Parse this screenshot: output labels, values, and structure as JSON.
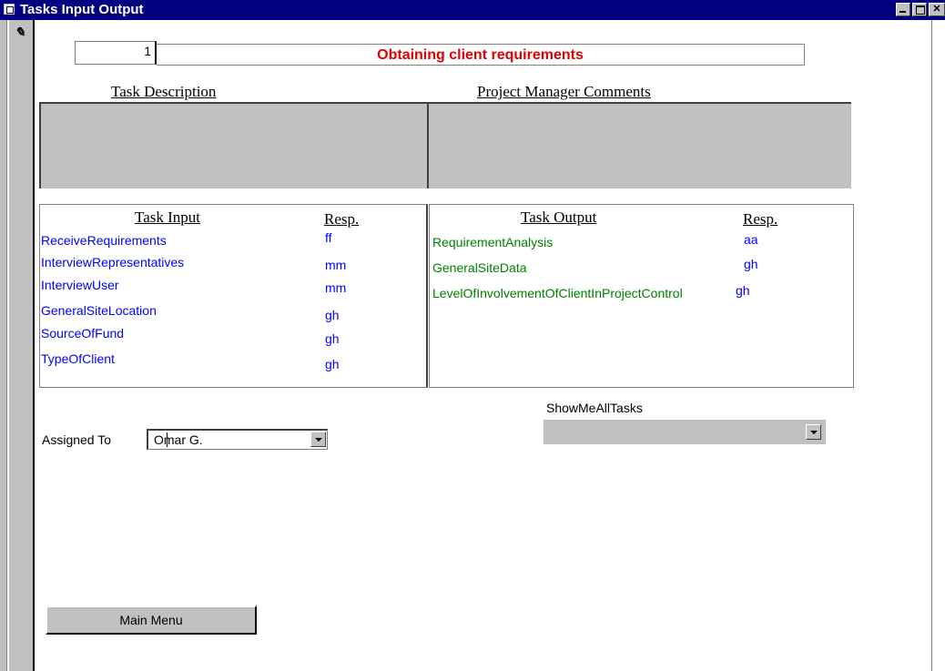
{
  "window": {
    "title": "Tasks Input Output",
    "controls": [
      "minimize",
      "maximize",
      "close"
    ]
  },
  "record_selector": {
    "icon": "pencil-icon"
  },
  "task": {
    "id": "1",
    "name": "Obtaining client requirements",
    "name_color": "#e00000"
  },
  "headers": {
    "task_description": "Task Description",
    "pm_comments": "Project Manager Comments"
  },
  "task_input": {
    "header": "Task Input",
    "resp_header": "Resp.",
    "color": "#0000ff",
    "items": [
      {
        "name": "ReceiveRequirements",
        "resp": "ff"
      },
      {
        "name": "InterviewRepresentatives",
        "resp": "mm"
      },
      {
        "name": "InterviewUser",
        "resp": "mm"
      },
      {
        "name": "GeneralSiteLocation",
        "resp": "gh"
      },
      {
        "name": "SourceOfFund",
        "resp": "gh"
      },
      {
        "name": "TypeOfClient",
        "resp": "gh"
      }
    ]
  },
  "task_output": {
    "header": "Task Output",
    "resp_header": "Resp.",
    "color": "#008000",
    "items": [
      {
        "name": "RequirementAnalysis",
        "resp": "aa"
      },
      {
        "name": "GeneralSiteData",
        "resp": "gh"
      },
      {
        "name": "LevelOfInvolvementOfClientInProjectControl",
        "resp": "gh"
      }
    ]
  },
  "assigned_to": {
    "label": "Assigned To",
    "value": "Omar G."
  },
  "show_all": {
    "label": "ShowMeAllTasks",
    "value": ""
  },
  "main_menu": {
    "label": "Main Menu"
  }
}
